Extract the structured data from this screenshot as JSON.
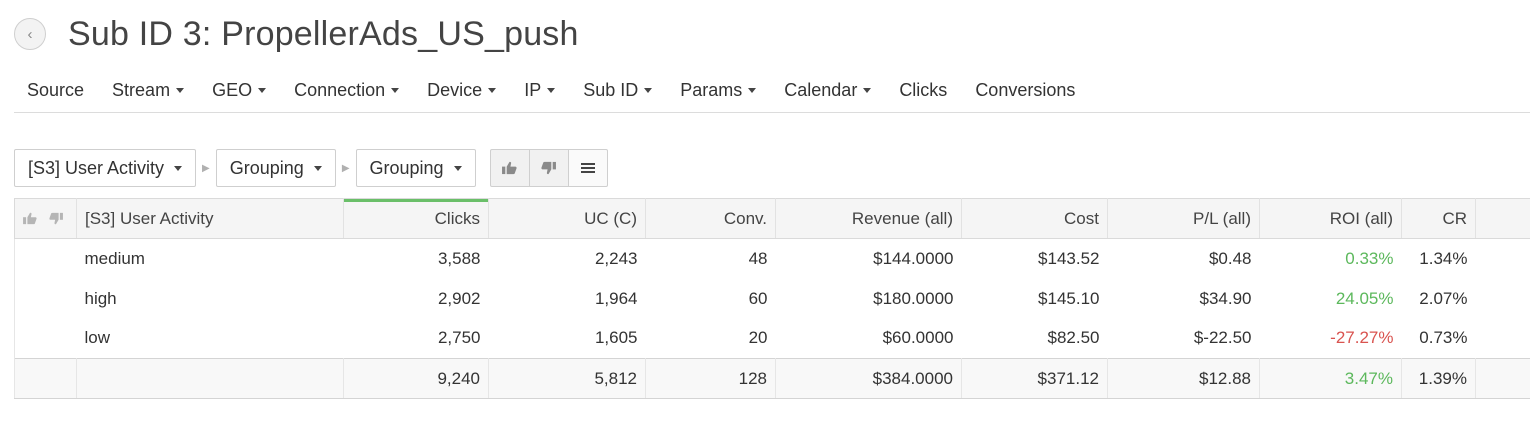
{
  "header": {
    "back_icon": "chevron-left-icon",
    "title": "Sub ID 3: PropellerAds_US_push"
  },
  "nav": {
    "items": [
      {
        "label": "Source",
        "dropdown": false
      },
      {
        "label": "Stream",
        "dropdown": true
      },
      {
        "label": "GEO",
        "dropdown": true
      },
      {
        "label": "Connection",
        "dropdown": true
      },
      {
        "label": "Device",
        "dropdown": true
      },
      {
        "label": "IP",
        "dropdown": true
      },
      {
        "label": "Sub ID",
        "dropdown": true
      },
      {
        "label": "Params",
        "dropdown": true
      },
      {
        "label": "Calendar",
        "dropdown": true
      },
      {
        "label": "Clicks",
        "dropdown": false
      },
      {
        "label": "Conversions",
        "dropdown": false
      }
    ]
  },
  "toolbar": {
    "grouping1": "[S3] User Activity",
    "grouping2": "Grouping",
    "grouping3": "Grouping",
    "buttons": [
      "thumbs-up-icon",
      "thumbs-down-icon",
      "list-icon"
    ]
  },
  "table": {
    "columns": [
      "[S3] User Activity",
      "Clicks",
      "UC (C)",
      "Conv.",
      "Revenue (all)",
      "Cost",
      "P/L (all)",
      "ROI (all)",
      "CR"
    ],
    "sorted_column": "Clicks",
    "rows": [
      {
        "activity": "medium",
        "clicks": "3,588",
        "uc": "2,243",
        "conv": "48",
        "revenue": "$144.0000",
        "cost": "$143.52",
        "pl": "$0.48",
        "roi": "0.33%",
        "roi_sign": "pos",
        "cr": "1.34%"
      },
      {
        "activity": "high",
        "clicks": "2,902",
        "uc": "1,964",
        "conv": "60",
        "revenue": "$180.0000",
        "cost": "$145.10",
        "pl": "$34.90",
        "roi": "24.05%",
        "roi_sign": "pos",
        "cr": "2.07%"
      },
      {
        "activity": "low",
        "clicks": "2,750",
        "uc": "1,605",
        "conv": "20",
        "revenue": "$60.0000",
        "cost": "$82.50",
        "pl": "$-22.50",
        "roi": "-27.27%",
        "roi_sign": "neg",
        "cr": "0.73%"
      }
    ],
    "totals": {
      "clicks": "9,240",
      "uc": "5,812",
      "conv": "128",
      "revenue": "$384.0000",
      "cost": "$371.12",
      "pl": "$12.88",
      "roi": "3.47%",
      "roi_sign": "pos",
      "cr": "1.39%"
    }
  },
  "colors": {
    "positive": "#5cb85c",
    "negative": "#d9534f",
    "sort_indicator": "#6abf69"
  }
}
